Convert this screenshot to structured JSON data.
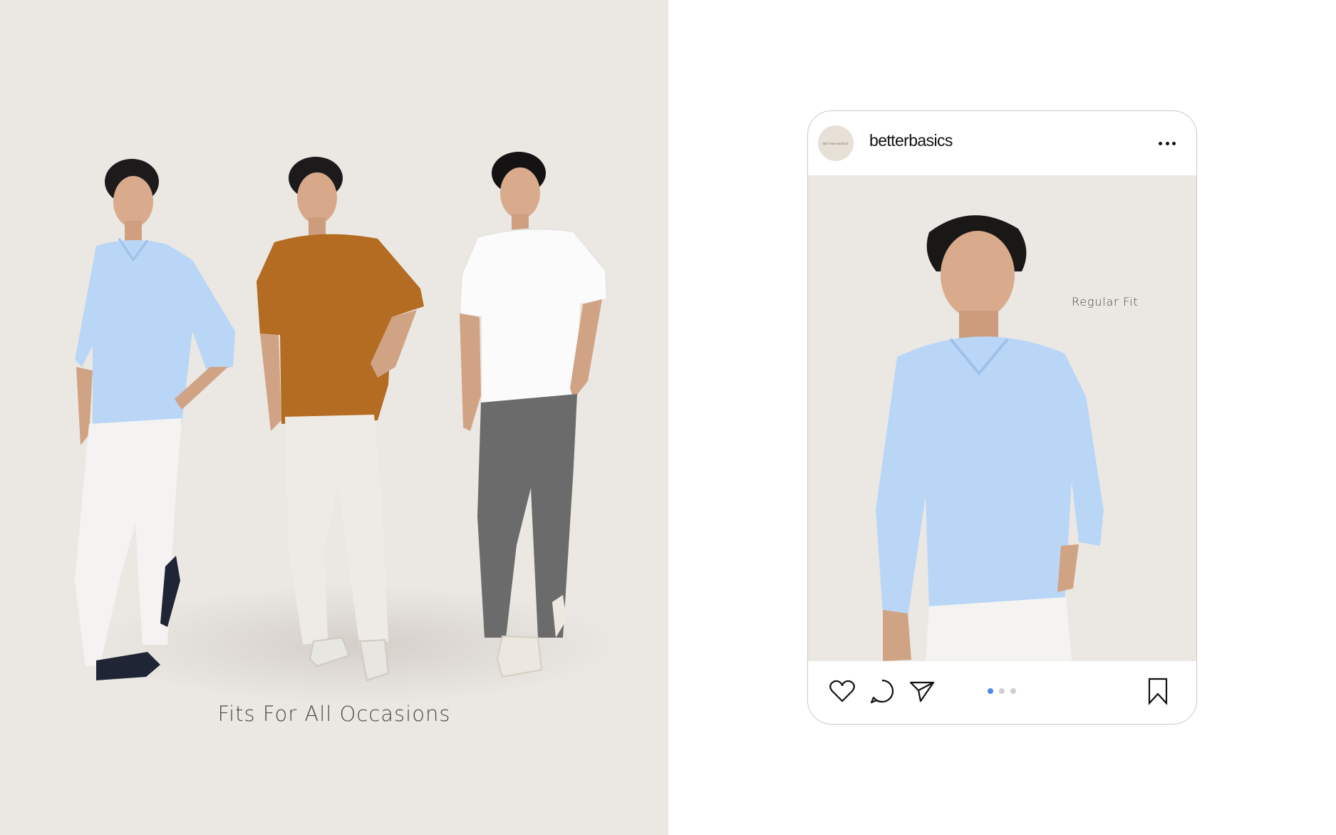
{
  "lookbook": {
    "caption": "Fits For All Occasions",
    "models": [
      {
        "name": "model-blue-vneck",
        "shirt_color": "#b9d6f6",
        "pants_color": "#f4f3f1",
        "shoe_color": "#1f2535"
      },
      {
        "name": "model-rust-tee",
        "shirt_color": "#b36c22",
        "pants_color": "#eeebe6",
        "shoe_color": "#e8e6e0"
      },
      {
        "name": "model-white-tee",
        "shirt_color": "#fbfbfb",
        "pants_color": "#6b6b6b",
        "shoe_color": "#ece8df"
      }
    ]
  },
  "post": {
    "avatar_text": "BETTER BASICS",
    "username": "betterbasics",
    "image_label": "Regular Fit",
    "slide_count": 3,
    "active_slide": 1,
    "icons": {
      "more": "more-horizontal-icon",
      "like": "heart-icon",
      "comment": "comment-icon",
      "share": "send-icon",
      "bookmark": "bookmark-icon"
    }
  },
  "colors": {
    "background_beige": "#ebe8e4",
    "active_dot": "#4a8be6",
    "inactive_dot": "#cfcfcf",
    "card_border": "#c9c9c9"
  }
}
